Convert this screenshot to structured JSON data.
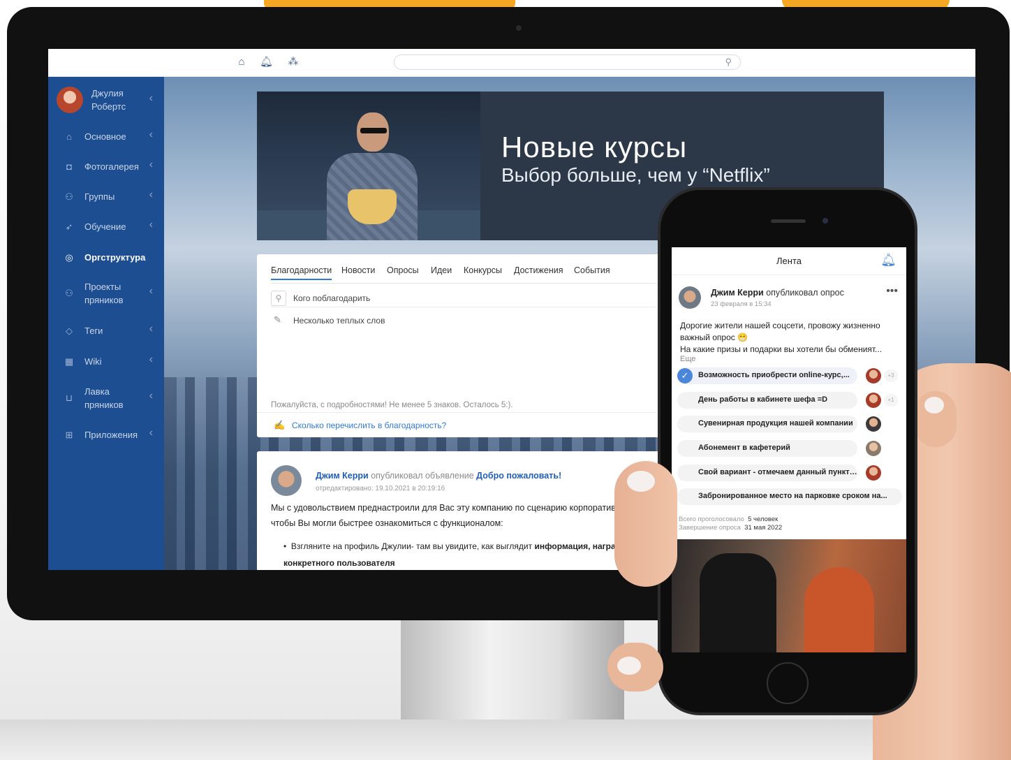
{
  "topbar": {
    "icons": [
      "home-icon",
      "bell-icon",
      "network-icon"
    ],
    "search_placeholder": "",
    "search_icon": "search-icon"
  },
  "sidebar": {
    "user_name": "Джулия Робертс",
    "items": [
      {
        "label": "Основное",
        "icon": "home-icon",
        "active": false
      },
      {
        "label": "Фотогалерея",
        "icon": "camera-icon",
        "active": false
      },
      {
        "label": "Группы",
        "icon": "group-icon",
        "active": false
      },
      {
        "label": "Обучение",
        "icon": "rocket-icon",
        "active": false
      },
      {
        "label": "Оргструктура",
        "icon": "org-icon",
        "active": true
      },
      {
        "label": "Проекты пряников",
        "icon": "projects-icon",
        "active": false
      },
      {
        "label": "Теги",
        "icon": "tag-icon",
        "active": false
      },
      {
        "label": "Wiki",
        "icon": "wiki-icon",
        "active": false
      },
      {
        "label": "Лавка пряников",
        "icon": "basket-icon",
        "active": false
      },
      {
        "label": "Приложения",
        "icon": "apps-icon",
        "active": false
      }
    ]
  },
  "banner": {
    "title": "Новые курсы",
    "subtitle": "Выбор больше, чем у “Netflix”"
  },
  "thanks_card": {
    "tabs": [
      "Благодарности",
      "Новости",
      "Опросы",
      "Идеи",
      "Конкурсы",
      "Достижения",
      "События"
    ],
    "active_tab": "Благодарности",
    "who_placeholder": "Кого поблагодарить",
    "words_placeholder": "Несколько теплых слов",
    "hint": "Пожалуйста, с подробностями! Не менее 5 знаков. Осталось 5:).",
    "amount_label": "Сколько перечислить в благодарность?"
  },
  "post": {
    "author": "Джим Керри",
    "verb": "опубликовал объявление",
    "link": "Добро пожаловать!",
    "edited": "отредактировано: 19.10.2021 в 20:19:16",
    "body": "Мы с удовольствием преднастроили для Вас эту компанию по сценарию корпоративной соц чтобы Вы могли быстрее ознакомиться с функционалом:",
    "bullet_text": "Взгляните на профиль Джулии- там вы увидите, как выглядит ",
    "bullet_bold": "информация, наград",
    "bullet_bold2": "конкретного пользователя"
  },
  "phone": {
    "header_title": "Лента",
    "author": "Джим Керри",
    "verb": "опубликовал опрос",
    "date": "23 февраля в 15:34",
    "text_line1": "Дорогие жители нашей соцсети, провожу жизненно важный опрос 😁",
    "text_line2": "На какие призы и подарки вы хотели бы обменият...",
    "more": "Еще",
    "options": [
      {
        "text": "Возможность приобрести online-курс,...",
        "selected": true,
        "extra": "+3"
      },
      {
        "text": "День работы в кабинете шефа =D",
        "selected": false,
        "extra": "+1"
      },
      {
        "text": "Сувенирная продукция нашей компании",
        "selected": false,
        "extra": ""
      },
      {
        "text": "Абонемент в кафетерий",
        "selected": false,
        "extra": ""
      },
      {
        "text": "Свой вариант - отмечаем данный пункт и к...",
        "selected": false,
        "extra": ""
      },
      {
        "text": "Забронированное место на парковке сроком на...",
        "selected": false,
        "extra": ""
      }
    ],
    "total_label": "Всего проголосовало",
    "total_value": "5 человек",
    "end_label": "Завершение опроса",
    "end_value": "31 мая 2022"
  },
  "colors": {
    "sidebar_bg": "#1d4e92",
    "accent_blue": "#2e7bd6",
    "orange": "#f5a623"
  }
}
